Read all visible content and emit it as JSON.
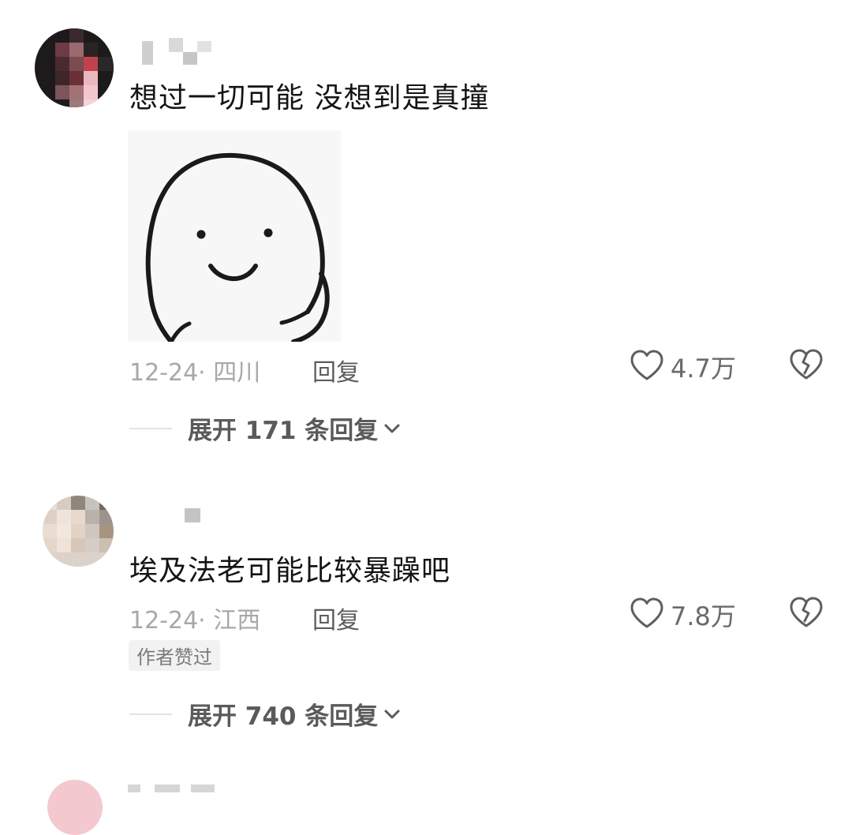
{
  "comments": [
    {
      "text": "想过一切可能 没想到是真撞",
      "has_sticker": true,
      "sticker_icon": "smiling-doodle-sticker",
      "date_location": "12-24· 四川",
      "reply_label": "回复",
      "likes": "4.7万",
      "expand_label": "展开 171 条回复"
    },
    {
      "text": "埃及法老可能比较暴躁吧",
      "has_sticker": false,
      "date_location": "12-24· 江西",
      "reply_label": "回复",
      "likes": "7.8万",
      "author_badge": "作者赞过",
      "expand_label": "展开 740 条回复"
    }
  ],
  "icons": {
    "like": "heart-outline-icon",
    "dislike": "broken-heart-icon",
    "expand": "chevron-down-icon"
  },
  "colors": {
    "meta_text": "#a8a8a8",
    "secondary_text": "#5a5a5a",
    "badge_bg": "#f2f2f2"
  }
}
